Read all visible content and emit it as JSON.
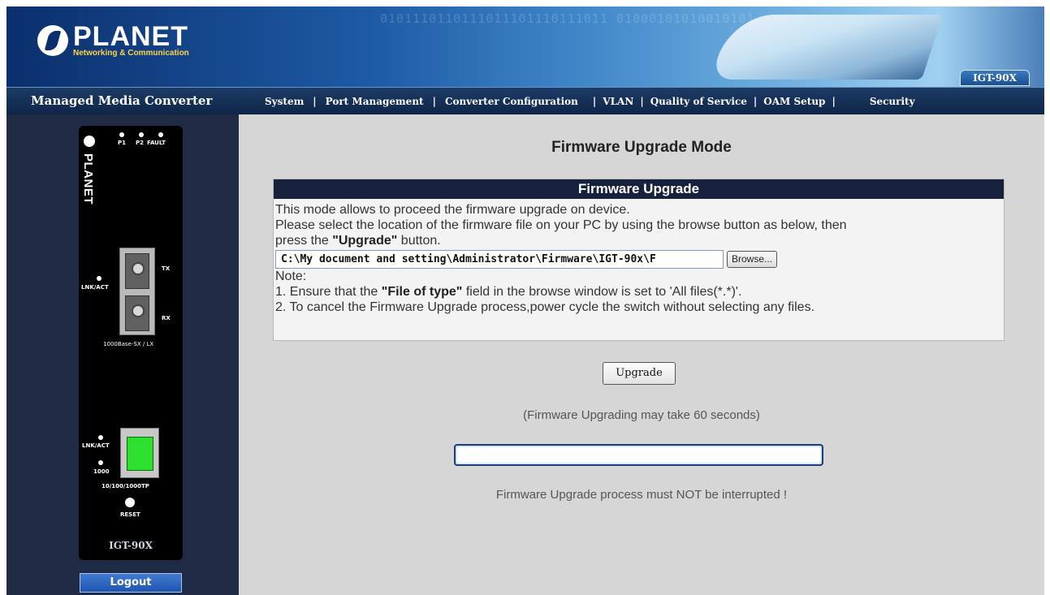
{
  "banner": {
    "brand": "PLANET",
    "tagline": "Networking & Communication",
    "model_tab": "IGT-90X",
    "binary_text": "0101110110111011101110111011 0100010101001010101100101110 101110111011101110"
  },
  "navbar": {
    "product_name": "Managed Media Converter",
    "menu": [
      {
        "label": "System"
      },
      {
        "label": "Port Management"
      },
      {
        "label": "Converter Configuration"
      },
      {
        "label": "VLAN"
      },
      {
        "label": "Quality of Service"
      },
      {
        "label": "OAM Setup"
      },
      {
        "label": "Security"
      }
    ]
  },
  "device": {
    "brand": "PLANET",
    "led_labels": {
      "p1": "P1",
      "p2": "P2",
      "fault": "FAULT"
    },
    "fiber": {
      "lnk_act": "LNK/ACT",
      "tx": "TX",
      "rx": "RX",
      "type": "1000Base-SX / LX"
    },
    "copper": {
      "lnk_act": "LNK/ACT",
      "speed": "1000",
      "type": "10/100/1000TP"
    },
    "reset_label": "RESET",
    "model": "IGT-90X"
  },
  "logout_label": "Logout",
  "main": {
    "title": "Firmware Upgrade Mode",
    "panel": {
      "header": "Firmware Upgrade",
      "line1": "This mode allows to proceed the firmware upgrade on device.",
      "line2": "Please select the location of the firmware file on your PC by using the browse button as below, then",
      "line3_prefix": "press the ",
      "line3_bold": "\"Upgrade\"",
      "line3_suffix": " button.",
      "file_value": "C:\\My document and setting\\Administrator\\Firmware\\IGT-90x\\F",
      "browse_label": "Browse...",
      "note_label": "Note:",
      "note1_prefix": "1. Ensure that the ",
      "note1_bold": "\"File of type\"",
      "note1_suffix": " field in the browse window is set to 'All files(*.*)'.",
      "note2": "2. To cancel the Firmware Upgrade process,power cycle the switch without selecting any files."
    },
    "upgrade_label": "Upgrade",
    "time_notice": "(Firmware Upgrading may take 60 seconds)",
    "progress_fraction": 0,
    "warning": "Firmware Upgrade process must NOT be interrupted !"
  }
}
